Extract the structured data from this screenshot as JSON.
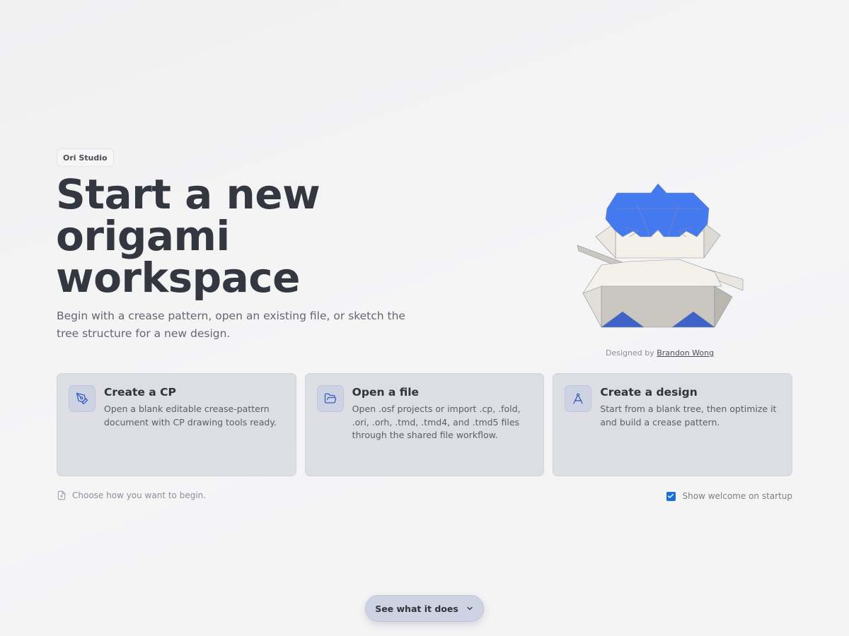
{
  "app": {
    "badge": "Ori Studio"
  },
  "hero": {
    "title": "Start a new origami workspace",
    "subtitle": "Begin with a crease pattern, open an existing file, or sketch the tree structure for a new design."
  },
  "illustration": {
    "credit_prefix": "Designed by",
    "credit_author": "Brandon Wong",
    "colors": {
      "blue": "#4479f0",
      "paper": "#f3f1ea",
      "shade": "#c9c7c0"
    }
  },
  "cards": [
    {
      "icon": "pen-nib-icon",
      "title": "Create a CP",
      "description": "Open a blank editable crease-pattern document with CP drawing tools ready."
    },
    {
      "icon": "folder-open-icon",
      "title": "Open a file",
      "description": "Open .osf projects or import .cp, .fold, .ori, .orh, .tmd, .tmd4, and .tmd5 files through the shared file workflow."
    },
    {
      "icon": "compass-icon",
      "title": "Create a design",
      "description": "Start from a blank tree, then optimize it and build a crease pattern."
    }
  ],
  "footer": {
    "hint": "Choose how you want to begin.",
    "startup_label": "Show welcome on startup",
    "startup_checked": true,
    "see_button": "See what it does"
  },
  "accent": "#1a6fd8"
}
